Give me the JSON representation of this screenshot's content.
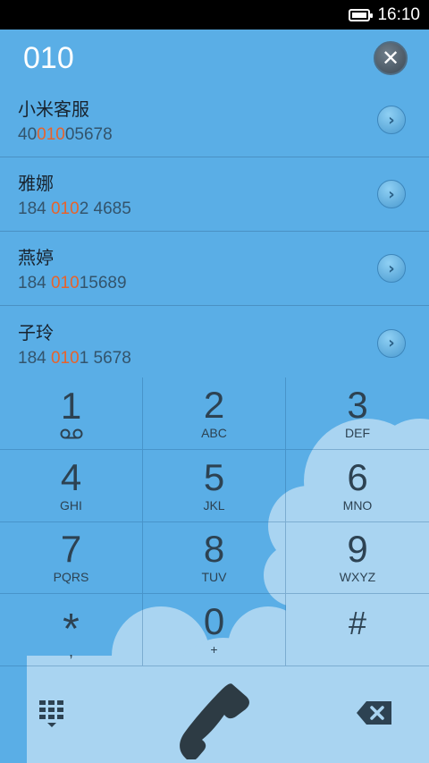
{
  "status_bar": {
    "time": "16:10",
    "battery": "battery-icon"
  },
  "dial": {
    "number": "010",
    "clear_icon": "clear-icon"
  },
  "contacts": [
    {
      "name": "小米客服",
      "num_before": "40",
      "num_match": "010",
      "num_after": "05678"
    },
    {
      "name": "雅娜",
      "num_before": "184 ",
      "num_match": "010",
      "num_after": "2 4685"
    },
    {
      "name": "燕婷",
      "num_before": "184 ",
      "num_match": "010",
      "num_after": "15689"
    },
    {
      "name": "子玲",
      "num_before": "184 ",
      "num_match": "010",
      "num_after": "1 5678"
    }
  ],
  "keypad": [
    {
      "digit": "1",
      "letters": "",
      "icon": "voicemail-icon"
    },
    {
      "digit": "2",
      "letters": "ABC"
    },
    {
      "digit": "3",
      "letters": "DEF"
    },
    {
      "digit": "4",
      "letters": "GHI"
    },
    {
      "digit": "5",
      "letters": "JKL"
    },
    {
      "digit": "6",
      "letters": "MNO"
    },
    {
      "digit": "7",
      "letters": "PQRS"
    },
    {
      "digit": "8",
      "letters": "TUV"
    },
    {
      "digit": "9",
      "letters": "WXYZ"
    },
    {
      "digit": "*",
      "letters": ","
    },
    {
      "digit": "0",
      "letters": "+"
    },
    {
      "digit": "#",
      "letters": ""
    }
  ],
  "bottom_bar": {
    "left_icon": "dialpad-icon",
    "center_icon": "phone-icon",
    "right_icon": "backspace-icon"
  },
  "colors": {
    "background": "#5aaee6",
    "match_highlight": "#e8622a",
    "text_dark": "#2d4252"
  }
}
